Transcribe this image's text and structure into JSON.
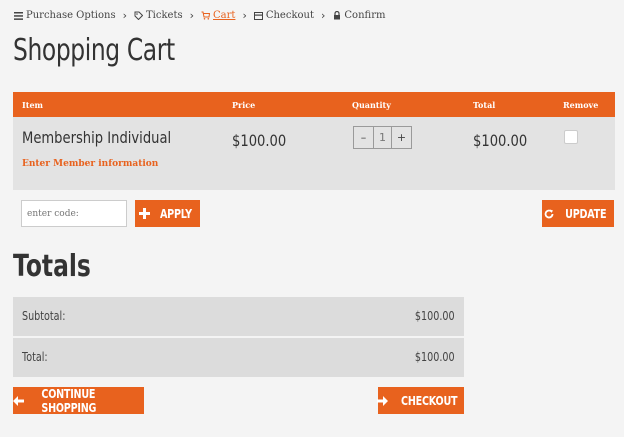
{
  "breadcrumb": [
    {
      "label": "Purchase Options",
      "icon": "menu-icon",
      "active": false
    },
    {
      "label": "Tickets",
      "icon": "tag-icon",
      "active": false
    },
    {
      "label": "Cart",
      "icon": "cart-icon",
      "active": true
    },
    {
      "label": "Checkout",
      "icon": "card-icon",
      "active": false
    },
    {
      "label": "Confirm",
      "icon": "lock-icon",
      "active": false
    }
  ],
  "page_title": "Shopping Cart",
  "cart": {
    "headers": {
      "item": "Item",
      "price": "Price",
      "quantity": "Quantity",
      "total": "Total",
      "remove": "Remove"
    },
    "items": [
      {
        "name": "Membership Individual",
        "link": "Enter Member information",
        "price": "$100.00",
        "quantity": "1",
        "total": "$100.00",
        "remove_checked": false
      }
    ],
    "qty_minus": "–",
    "qty_plus": "+"
  },
  "promo": {
    "placeholder": "enter code:",
    "apply_label": "APPLY"
  },
  "update_label": "UPDATE",
  "totals": {
    "title": "Totals",
    "subtotal_label": "Subtotal:",
    "subtotal_value": "$100.00",
    "total_label": "Total:",
    "total_value": "$100.00"
  },
  "continue_label": "CONTINUE SHOPPING",
  "checkout_label": "CHECKOUT",
  "colors": {
    "accent": "#e8621e",
    "background": "#f4f4f4",
    "row": "#e3e3e3",
    "totals_row": "#dcdcdc"
  }
}
